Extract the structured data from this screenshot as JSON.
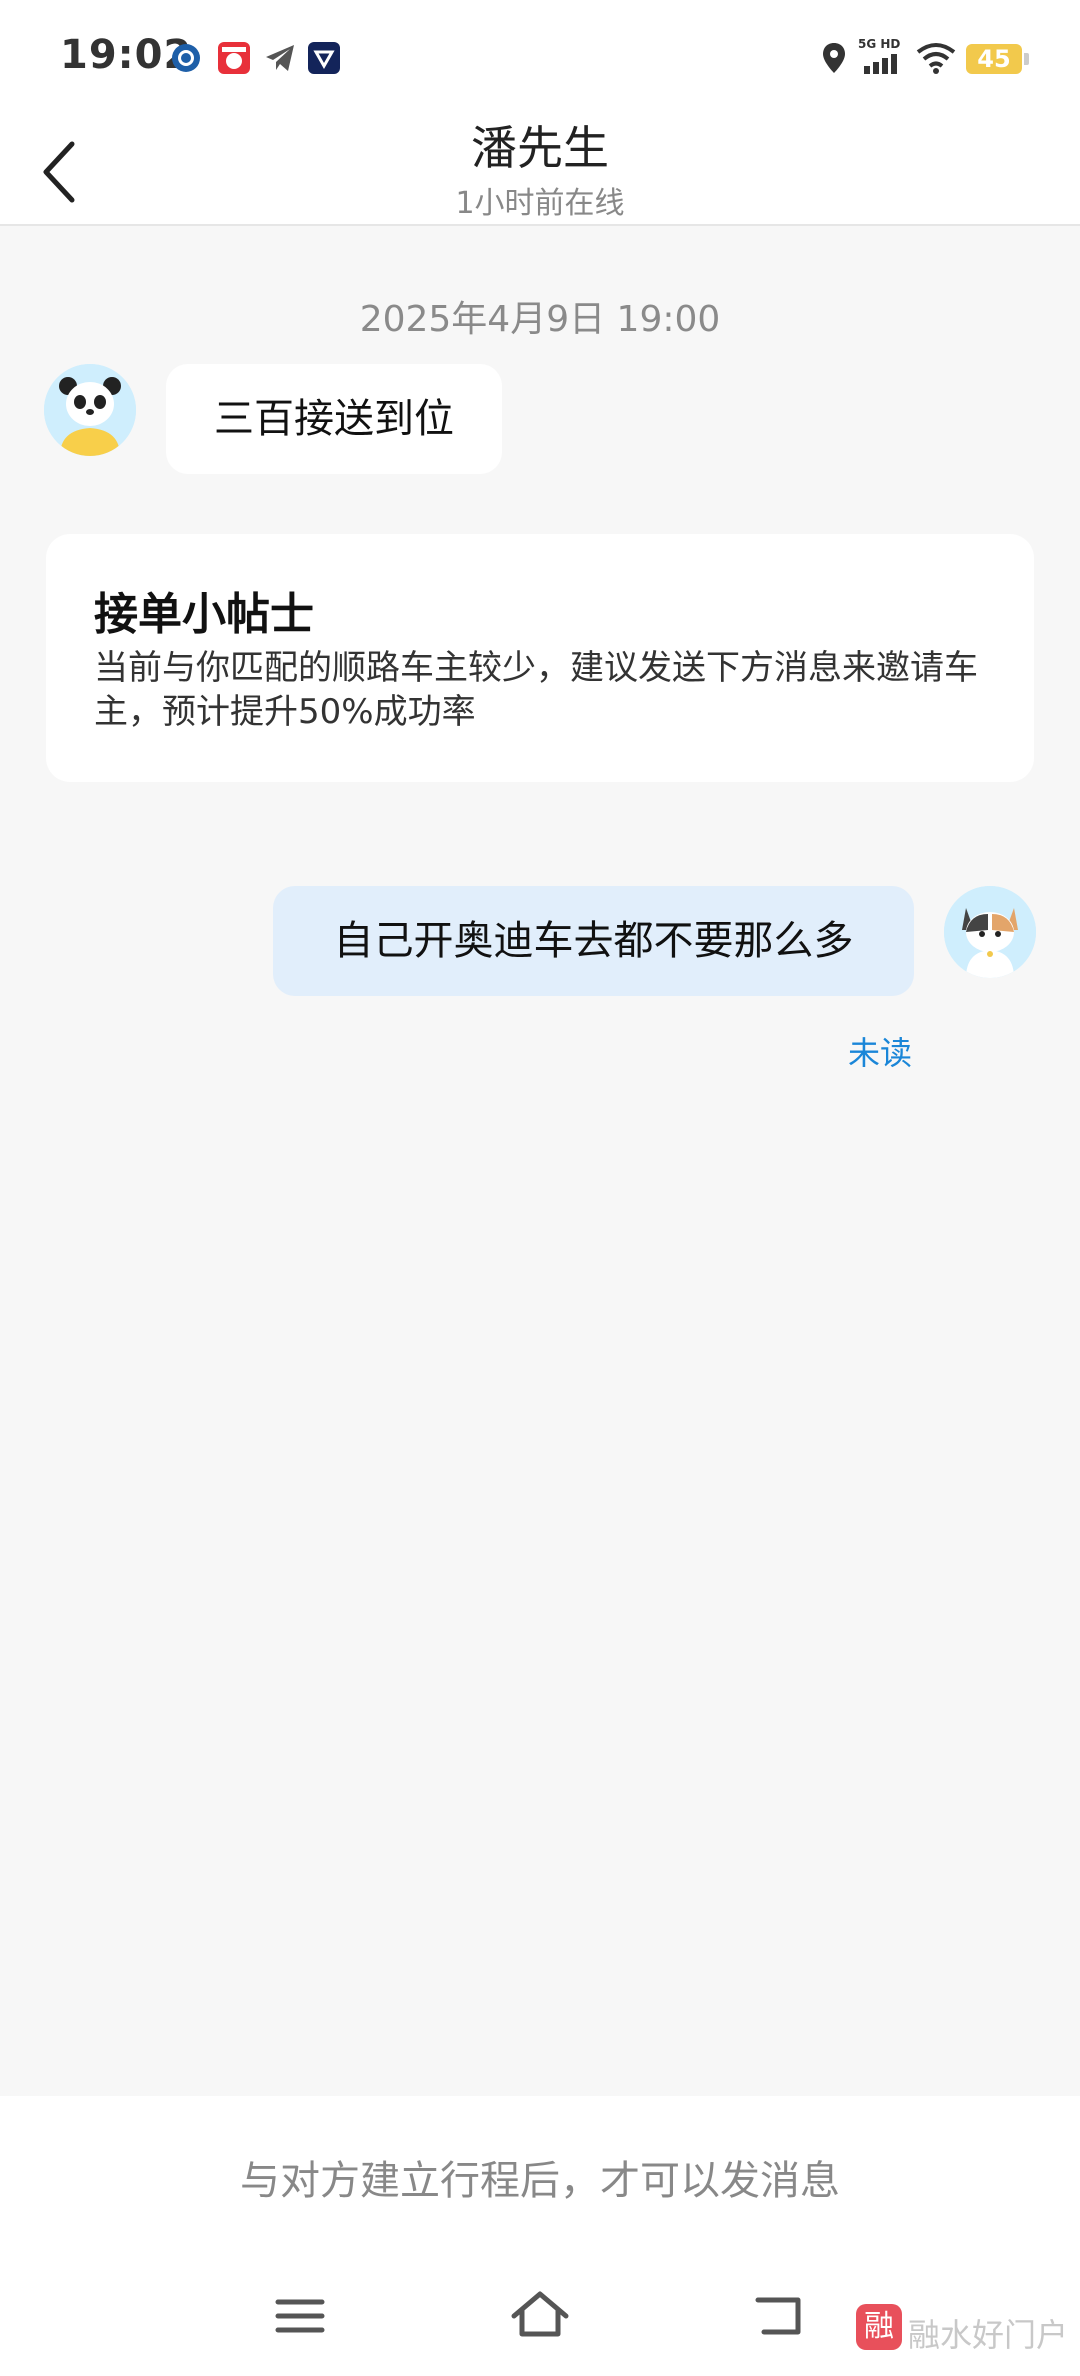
{
  "status_bar": {
    "time": "19:02",
    "network": "5G HD",
    "battery": "45",
    "icons": [
      "app-notification-icon",
      "news-app-icon",
      "telegram-icon",
      "vpn-icon",
      "location-icon",
      "signal-icon",
      "wifi-icon",
      "battery-icon"
    ]
  },
  "header": {
    "title": "潘先生",
    "subtitle": "1小时前在线"
  },
  "chat": {
    "timestamp": "2025年4月9日 19:00",
    "incoming_message": "三百接送到位",
    "tip": {
      "title": "接单小帖士",
      "body": "当前与你匹配的顺路车主较少，建议发送下方消息来邀请车主，预计提升50%成功率"
    },
    "outgoing_message": "自己开奥迪车去都不要那么多",
    "read_status": "未读"
  },
  "bottom": {
    "notice": "与对方建立行程后，才可以发消息"
  },
  "watermark": {
    "logo_char": "融",
    "text": "融水好门户"
  },
  "colors": {
    "outgoing_bubble": "#e1eefb",
    "read_status": "#1a86d8",
    "battery": "#f2c94c"
  }
}
